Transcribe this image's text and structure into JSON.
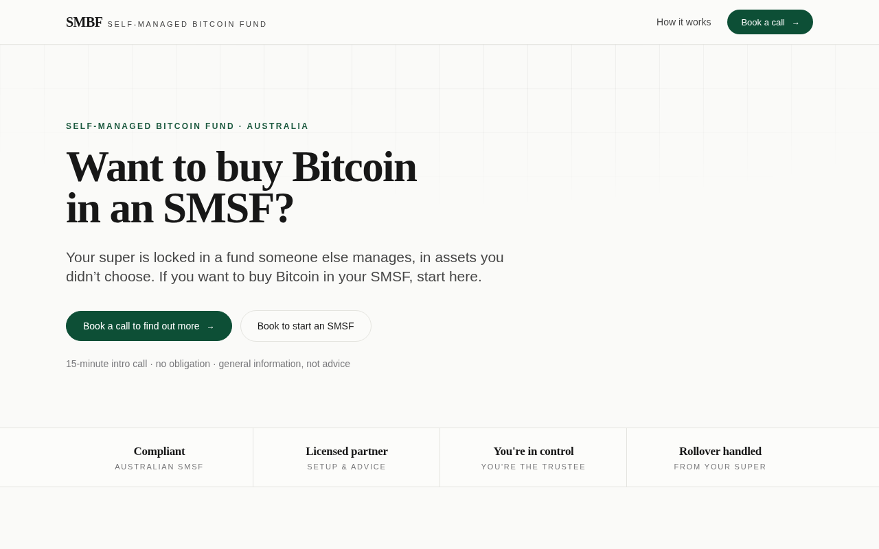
{
  "header": {
    "logo": "SMBF",
    "tagline": "SELF-MANAGED BITCOIN FUND",
    "nav": [
      {
        "kind": "link",
        "label": "How it works"
      },
      {
        "kind": "button",
        "label": "Book a call",
        "arrow": "→"
      }
    ]
  },
  "hero": {
    "eyebrow": "SELF-MANAGED BITCOIN FUND · AUSTRALIA",
    "heading_lines": [
      "Want to buy Bitcoin",
      "in an SMSF?"
    ],
    "intro": "Your super is locked in a fund someone else manages, in assets you didn’t choose. If you want to buy Bitcoin in your SMSF, start here.",
    "actions": [
      {
        "kind": "primary",
        "label": "Book a call to find out more",
        "arrow": "→"
      },
      {
        "kind": "secondary",
        "label": "Book to start an SMSF"
      }
    ],
    "note": "15-minute intro call · no obligation · general information, not advice"
  },
  "features": [
    {
      "title": "Compliant",
      "subtitle": "AUSTRALIAN SMSF"
    },
    {
      "title": "Licensed partner",
      "subtitle": "SETUP & ADVICE"
    },
    {
      "title": "You're in control",
      "subtitle": "YOU'RE THE TRUSTEE"
    },
    {
      "title": "Rollover handled",
      "subtitle": "FROM YOUR SUPER"
    }
  ]
}
